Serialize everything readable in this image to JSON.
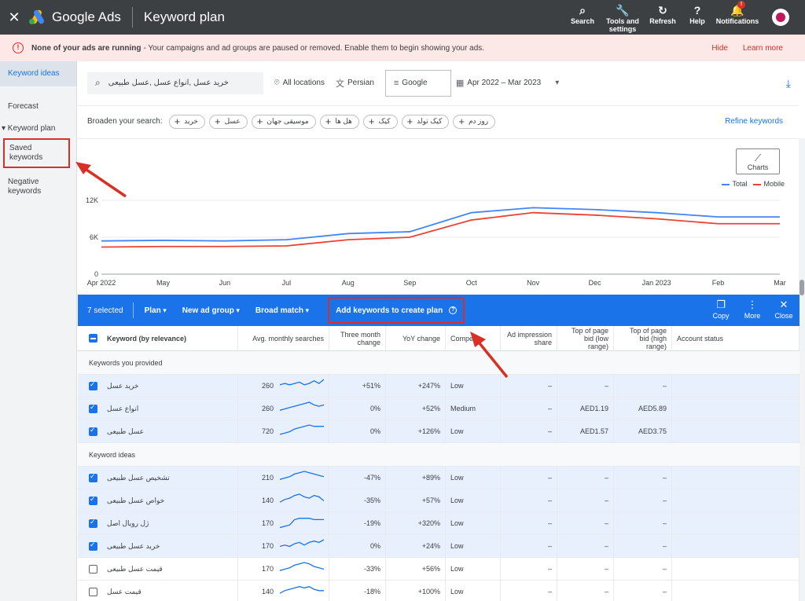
{
  "topbar": {
    "close": "✕",
    "brand": "Google Ads",
    "page_title": "Keyword plan",
    "actions": [
      {
        "icon": "search-icon",
        "glyph": "⌕",
        "label": "Search"
      },
      {
        "icon": "tools-icon",
        "glyph": "🔧",
        "label": "Tools and settings"
      },
      {
        "icon": "refresh-icon",
        "glyph": "↻",
        "label": "Refresh"
      },
      {
        "icon": "help-icon",
        "glyph": "?",
        "label": "Help"
      },
      {
        "icon": "bell-icon",
        "glyph": "🔔",
        "label": "Notifications",
        "badge": "!"
      }
    ]
  },
  "banner": {
    "bold": "None of your ads are running",
    "text": "- Your campaigns and ad groups are paused or removed. Enable them to begin showing your ads.",
    "hide": "Hide",
    "learn_more": "Learn more"
  },
  "sidebar": {
    "items": [
      "Keyword ideas",
      "Forecast",
      "▾ Keyword plan",
      "Saved keywords",
      "Negative keywords"
    ]
  },
  "filters": {
    "search_text": "خرید عسل ,انواع عسل ,عسل طبیعی",
    "location": "All locations",
    "language": "Persian",
    "network": "Google",
    "date_range": "Apr 2022 – Mar 2023"
  },
  "broaden": {
    "label": "Broaden your search:",
    "chips": [
      "خرید",
      "عسل",
      "موسیقی جهان",
      "هل ها",
      "کیک",
      "کیک تولد",
      "روز دم"
    ],
    "refine": "Refine keywords"
  },
  "chart": {
    "button_label": "Charts",
    "legend": [
      {
        "name": "Total",
        "color": "#4285f4"
      },
      {
        "name": "Mobile",
        "color": "#ea4335"
      }
    ]
  },
  "chart_data": {
    "type": "line",
    "x": [
      "Apr 2022",
      "May",
      "Jun",
      "Jul",
      "Aug",
      "Sep",
      "Oct",
      "Nov",
      "Dec",
      "Jan 2023",
      "Feb",
      "Mar"
    ],
    "series": [
      {
        "name": "Total",
        "values": [
          5400,
          5500,
          5400,
          5600,
          6600,
          6900,
          10000,
          10800,
          10500,
          10000,
          9300,
          9300
        ]
      },
      {
        "name": "Mobile",
        "values": [
          4400,
          4500,
          4500,
          4600,
          5600,
          6000,
          8800,
          10000,
          9600,
          9000,
          8200,
          8200
        ]
      }
    ],
    "yticks": [
      "0",
      "6K",
      "12K"
    ],
    "ylim": [
      0,
      12000
    ],
    "grid": true,
    "legend_position": "top-right"
  },
  "actionbar": {
    "selected": "7 selected",
    "plan": "Plan",
    "new_ad_group": "New ad group",
    "broad_match": "Broad match",
    "add_keywords": "Add keywords to create plan",
    "help_glyph": "?",
    "copy": "Copy",
    "more": "More",
    "close": "Close"
  },
  "table": {
    "headers": [
      "Keyword (by relevance)",
      "Avg. monthly searches",
      "Three month change",
      "YoY change",
      "Competi",
      "Ad impression share",
      "Top of page bid (low range)",
      "Top of page bid (high range)",
      "Account status"
    ],
    "section1": "Keywords you provided",
    "section2": "Keyword ideas",
    "rows1": [
      {
        "kw": "خرید عسل",
        "avg": "260",
        "three": "+51%",
        "yoy": "+247%",
        "comp": "Low",
        "imp": "–",
        "low": "–",
        "high": "–",
        "checked": true,
        "spark": [
          6,
          7,
          6,
          7,
          8,
          6,
          7,
          9,
          7,
          10
        ]
      },
      {
        "kw": "انواع عسل",
        "avg": "260",
        "three": "0%",
        "yoy": "+52%",
        "comp": "Medium",
        "imp": "–",
        "low": "AED1.19",
        "high": "AED5.89",
        "checked": true,
        "spark": [
          4,
          5,
          6,
          7,
          8,
          9,
          10,
          8,
          7,
          8
        ]
      },
      {
        "kw": "عسل طبیعی",
        "avg": "720",
        "three": "0%",
        "yoy": "+126%",
        "comp": "Low",
        "imp": "–",
        "low": "AED1.57",
        "high": "AED3.75",
        "checked": true,
        "spark": [
          3,
          4,
          5,
          7,
          8,
          9,
          10,
          9,
          9,
          9
        ]
      }
    ],
    "rows2": [
      {
        "kw": "تشخیص عسل طبیعی",
        "avg": "210",
        "three": "-47%",
        "yoy": "+89%",
        "comp": "Low",
        "imp": "–",
        "low": "–",
        "high": "–",
        "checked": true,
        "spark": [
          4,
          5,
          6,
          8,
          9,
          10,
          9,
          8,
          7,
          6
        ]
      },
      {
        "kw": "خواص عسل طبیعی",
        "avg": "140",
        "three": "-35%",
        "yoy": "+57%",
        "comp": "Low",
        "imp": "–",
        "low": "–",
        "high": "–",
        "checked": true,
        "spark": [
          4,
          6,
          7,
          9,
          10,
          8,
          7,
          9,
          8,
          5
        ]
      },
      {
        "kw": "ژل رویال اصل",
        "avg": "170",
        "three": "-19%",
        "yoy": "+320%",
        "comp": "Low",
        "imp": "–",
        "low": "–",
        "high": "–",
        "checked": true,
        "spark": [
          2,
          3,
          4,
          8,
          9,
          9,
          9,
          8,
          8,
          8
        ]
      },
      {
        "kw": "خرید عسل طبیعی",
        "avg": "170",
        "three": "0%",
        "yoy": "+24%",
        "comp": "Low",
        "imp": "–",
        "low": "–",
        "high": "–",
        "checked": true,
        "spark": [
          5,
          6,
          5,
          7,
          8,
          6,
          8,
          9,
          8,
          10
        ]
      },
      {
        "kw": "قیمت عسل طبیعی",
        "avg": "170",
        "three": "-33%",
        "yoy": "+56%",
        "comp": "Low",
        "imp": "–",
        "low": "–",
        "high": "–",
        "checked": false,
        "spark": [
          4,
          5,
          6,
          8,
          9,
          10,
          9,
          7,
          6,
          5
        ]
      },
      {
        "kw": "قیمت عسل",
        "avg": "140",
        "three": "-18%",
        "yoy": "+100%",
        "comp": "Low",
        "imp": "–",
        "low": "–",
        "high": "–",
        "checked": false,
        "spark": [
          4,
          6,
          7,
          8,
          9,
          8,
          9,
          7,
          6,
          6
        ]
      }
    ]
  },
  "annotation_color": "#d93025"
}
